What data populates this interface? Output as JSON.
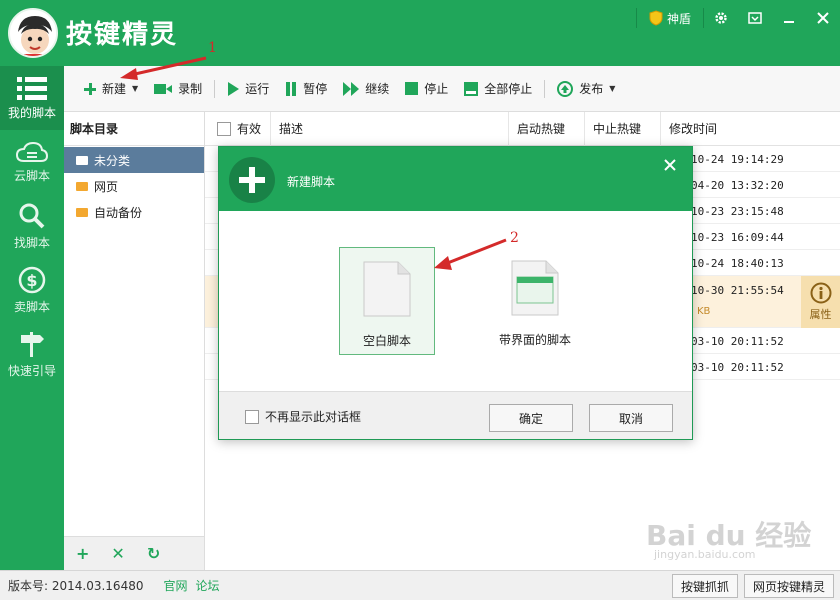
{
  "app": {
    "title": "按键精灵",
    "shield_label": "神盾"
  },
  "leftnav": {
    "items": [
      {
        "label": "我的脚本",
        "icon": "list-icon"
      },
      {
        "label": "云脚本",
        "icon": "cloud-icon"
      },
      {
        "label": "找脚本",
        "icon": "search-icon"
      },
      {
        "label": "卖脚本",
        "icon": "dollar-icon"
      },
      {
        "label": "快速引导",
        "icon": "signpost-icon"
      }
    ]
  },
  "toolbar": {
    "new": "新建",
    "record": "录制",
    "run": "运行",
    "pause": "暂停",
    "continue": "继续",
    "stop": "停止",
    "stop_all": "全部停止",
    "publish": "发布"
  },
  "tree": {
    "header": "脚本目录",
    "items": [
      "未分类",
      "网页",
      "自动备份"
    ]
  },
  "list": {
    "headers": [
      "有效",
      "描述",
      "启动热键",
      "中止热键",
      "修改时间"
    ],
    "times": [
      "10-24 19:14:29",
      "04-20 13:32:20",
      "10-23 23:15:48",
      "10-23 16:09:44",
      "10-24 18:40:13",
      "10-30 21:55:54",
      "03-10 20:11:52",
      "03-10 20:11:52"
    ],
    "highlight_sub": "KB",
    "property_label": "属性"
  },
  "dialog": {
    "title": "新建脚本",
    "options": [
      "空白脚本",
      "带界面的脚本"
    ],
    "no_show_label": "不再显示此对话框",
    "ok": "确定",
    "cancel": "取消"
  },
  "status": {
    "version": "版本号: 2014.03.16480",
    "link_official": "官网",
    "link_forum": "论坛",
    "btn_capture": "按键抓抓",
    "btn_web": "网页按键精灵"
  },
  "annotations": [
    "1",
    "2"
  ],
  "watermark": {
    "main": "Bai du 经验",
    "sub": "jingyan.baidu.com"
  },
  "colors": {
    "brand_green": "#20a65a",
    "dark_green": "#1b8f4d",
    "tree_selected": "#5b7c9c",
    "highlight_row": "#fdf1dc",
    "annotation_red": "#d42a2a"
  }
}
